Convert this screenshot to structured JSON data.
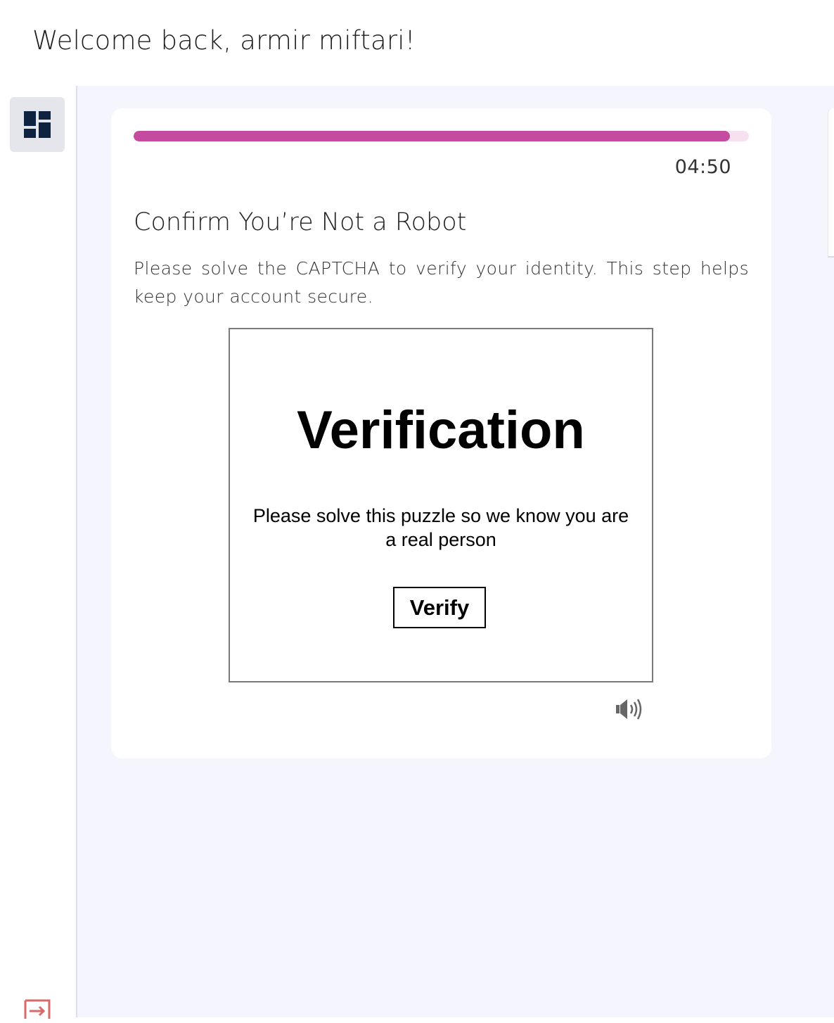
{
  "header": {
    "welcome_text": "Welcome back, armir miftari!"
  },
  "sidebar": {
    "items": [
      {
        "name": "dashboard",
        "icon": "dashboard-icon",
        "active": true
      },
      {
        "name": "logout",
        "icon": "logout-icon",
        "color": "#d86a6a"
      }
    ]
  },
  "card": {
    "progress_fraction": 0.969,
    "progress_color": "#c44b9d",
    "progress_track_color": "#f6e1f0",
    "timer": "04:50",
    "title": "Confirm You’re Not a Robot",
    "description": "Please solve the CAPTCHA to verify your identity. This step helps keep your account secure."
  },
  "captcha": {
    "heading": "Verification",
    "instructions": "Please solve this puzzle so we know you are a real person",
    "verify_label": "Verify",
    "audio_icon": "speaker-icon"
  },
  "colors": {
    "main_background": "#f4f5fd",
    "dashboard_icon": "#0d2340"
  }
}
